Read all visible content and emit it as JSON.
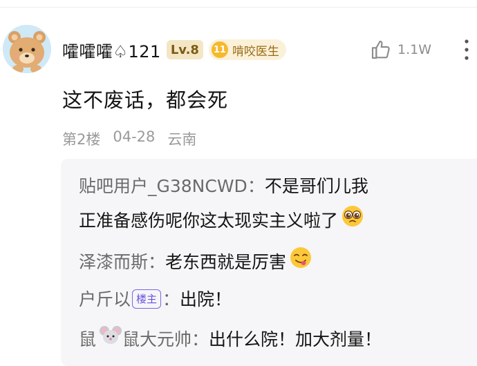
{
  "post": {
    "username": "嚯嚯嚯♤121",
    "level": "Lv.8",
    "honor": {
      "number": "11",
      "title": "啃咬医生"
    },
    "likes": "1.1W",
    "content": "这不废话，都会死",
    "floor": "第2楼",
    "date": "04-28",
    "location": "云南"
  },
  "replies": {
    "r1": {
      "name": "贴吧用户_G38NCWD",
      "sep": "：",
      "line1": "不是哥们儿我",
      "line2": "正准备感伤呢你这太现实主义啦了"
    },
    "r2": {
      "name": "泽漆而斯",
      "sep": "：",
      "text": "老东西就是厉害"
    },
    "r3": {
      "name": "户斤以",
      "tag": "楼主",
      "sep": "：",
      "text": "出院！"
    },
    "r4": {
      "name_prefix": "鼠",
      "name_suffix": "鼠大元帅",
      "sep": "：",
      "text": "出什么院！加大剂量！"
    }
  },
  "colors": {
    "text": "#141414",
    "meta": "#9a9a9a",
    "reply_name": "#6a6a6a",
    "owner_tag": "#6a4fe0",
    "level_bg": "#f4e6c5",
    "honor_bg": "#fbf1d9"
  }
}
